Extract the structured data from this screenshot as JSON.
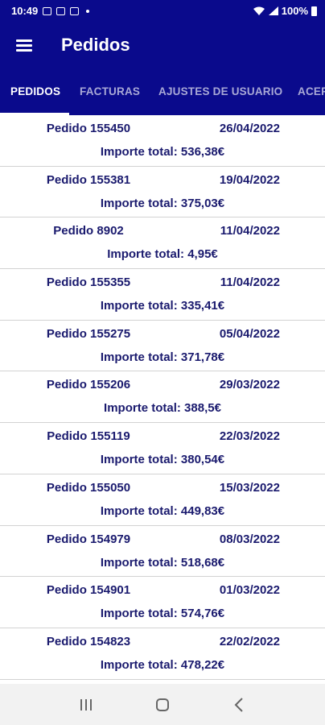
{
  "status_bar": {
    "time": "10:49",
    "battery": "100%"
  },
  "app_bar": {
    "title": "Pedidos"
  },
  "tabs": [
    {
      "label": "PEDIDOS",
      "active": true
    },
    {
      "label": "FACTURAS",
      "active": false
    },
    {
      "label": "AJUSTES DE USUARIO",
      "active": false
    },
    {
      "label": "ACERCA DE",
      "active": false
    }
  ],
  "orders": [
    {
      "name": "Pedido 155450",
      "date": "26/04/2022",
      "total": "Importe total: 536,38€"
    },
    {
      "name": "Pedido 155381",
      "date": "19/04/2022",
      "total": "Importe total: 375,03€"
    },
    {
      "name": "Pedido 8902",
      "date": "11/04/2022",
      "total": "Importe total: 4,95€"
    },
    {
      "name": "Pedido 155355",
      "date": "11/04/2022",
      "total": "Importe total: 335,41€"
    },
    {
      "name": "Pedido 155275",
      "date": "05/04/2022",
      "total": "Importe total: 371,78€"
    },
    {
      "name": "Pedido 155206",
      "date": "29/03/2022",
      "total": "Importe total: 388,5€"
    },
    {
      "name": "Pedido 155119",
      "date": "22/03/2022",
      "total": "Importe total: 380,54€"
    },
    {
      "name": "Pedido 155050",
      "date": "15/03/2022",
      "total": "Importe total: 449,83€"
    },
    {
      "name": "Pedido 154979",
      "date": "08/03/2022",
      "total": "Importe total: 518,68€"
    },
    {
      "name": "Pedido 154901",
      "date": "01/03/2022",
      "total": "Importe total: 574,76€"
    },
    {
      "name": "Pedido 154823",
      "date": "22/02/2022",
      "total": "Importe total: 478,22€"
    }
  ],
  "colors": {
    "primary": "#0a0a8c",
    "text": "#1a1a6e",
    "tab_inactive": "#a9a9d6"
  },
  "icons": {
    "menu": "hamburger-icon",
    "recent": "recent-apps-icon",
    "home": "home-icon",
    "back": "back-icon"
  }
}
